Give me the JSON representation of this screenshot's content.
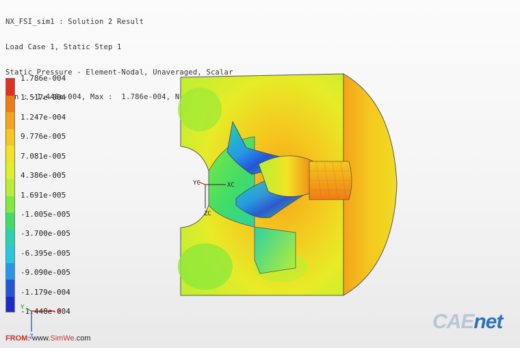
{
  "header": {
    "line1": "NX_FSI_sim1 : Solution 2 Result",
    "line2": "Load Case 1, Static Step 1",
    "line3": "Static Pressure - Element-Nodal, Unaveraged, Scalar",
    "line4": "Min : -1.448e-004, Max :  1.786e-004, N/mm^2(MPa)"
  },
  "legend": {
    "labels": [
      "1.786e-004",
      "1.517e-004",
      "1.247e-004",
      "9.776e-005",
      "7.081e-005",
      "4.386e-005",
      "1.691e-005",
      "-1.005e-005",
      "-3.700e-005",
      "-6.395e-005",
      "-9.090e-005",
      "-1.179e-004",
      "-1.448e-004"
    ],
    "colors": [
      "#e0301e",
      "#f07a14",
      "#f3a41a",
      "#f5c81e",
      "#f2e323",
      "#dff02a",
      "#b8ef33",
      "#7fea3f",
      "#3fdc6a",
      "#27d3b0",
      "#28c6e2",
      "#2697e6",
      "#2355d8",
      "#1c2ac8"
    ]
  },
  "triad_model": {
    "x": "XC",
    "y": "YC",
    "z": "ZC"
  },
  "triad_corner": {
    "x": "X",
    "y": "Y",
    "z": "Z"
  },
  "source": {
    "prefix": "FROM:",
    "www": "www.",
    "site": "SimWe",
    "suffix": ".com"
  },
  "logo": {
    "left": "CAE",
    "right": "net"
  }
}
